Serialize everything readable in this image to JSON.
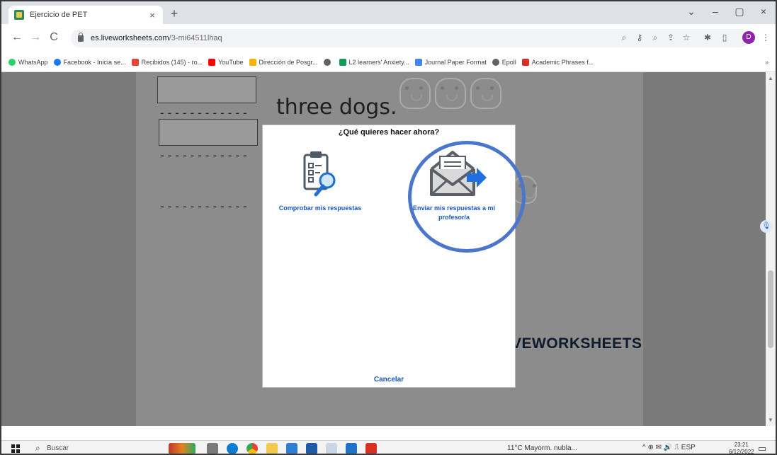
{
  "browser": {
    "tab_title": "Ejercicio de PET",
    "tab_close": "×",
    "new_tab": "+",
    "url_domain": "es.liveworksheets.com",
    "url_path": "/3-mi64511lhaq",
    "back": "←",
    "forward": "→",
    "reload": "C",
    "profile_initial": "D",
    "window_controls": [
      "⌄",
      "–",
      "▢",
      "×"
    ]
  },
  "bookmarks": [
    {
      "label": "WhatsApp",
      "color": "#25d366"
    },
    {
      "label": "Facebook - Inicia se...",
      "color": "#1877f2"
    },
    {
      "label": "Recibidos (145) - ro...",
      "color": "#ea4335"
    },
    {
      "label": "YouTube",
      "color": "#ff0000"
    },
    {
      "label": "Dirección de Posgr...",
      "color": "#f4b400"
    },
    {
      "label": "",
      "color": "#5f6368"
    },
    {
      "label": "L2 learners' Anxiety...",
      "color": "#0f9d58"
    },
    {
      "label": "Journal Paper Format",
      "color": "#4285f4"
    },
    {
      "label": "Epoll",
      "color": "#5f6368"
    },
    {
      "label": "Academic Phrases f...",
      "color": "#d93025"
    }
  ],
  "bookmarks_more": "»",
  "worksheet": {
    "sentence": "three dogs.",
    "dashes": "------------",
    "brand": "VEWORKSHEETS"
  },
  "modal": {
    "title": "¿Qué quieres hacer ahora?",
    "option_check": "Comprobar mis respuestas",
    "option_send_line1": "Enviar mis respuestas a mi",
    "option_send_line2": "profesor/a",
    "cancel": "Cancelar"
  },
  "taskbar": {
    "search": "Buscar",
    "weather": "11°C Mayorm. nubla...",
    "tray": "^ ⊕ ✉ 🔊 ⎍ ESP",
    "time": "23:21",
    "date": "6/12/2022"
  },
  "colors": {
    "accent_blue": "#1a56c4",
    "highlight_circle": "#4a76cc"
  }
}
